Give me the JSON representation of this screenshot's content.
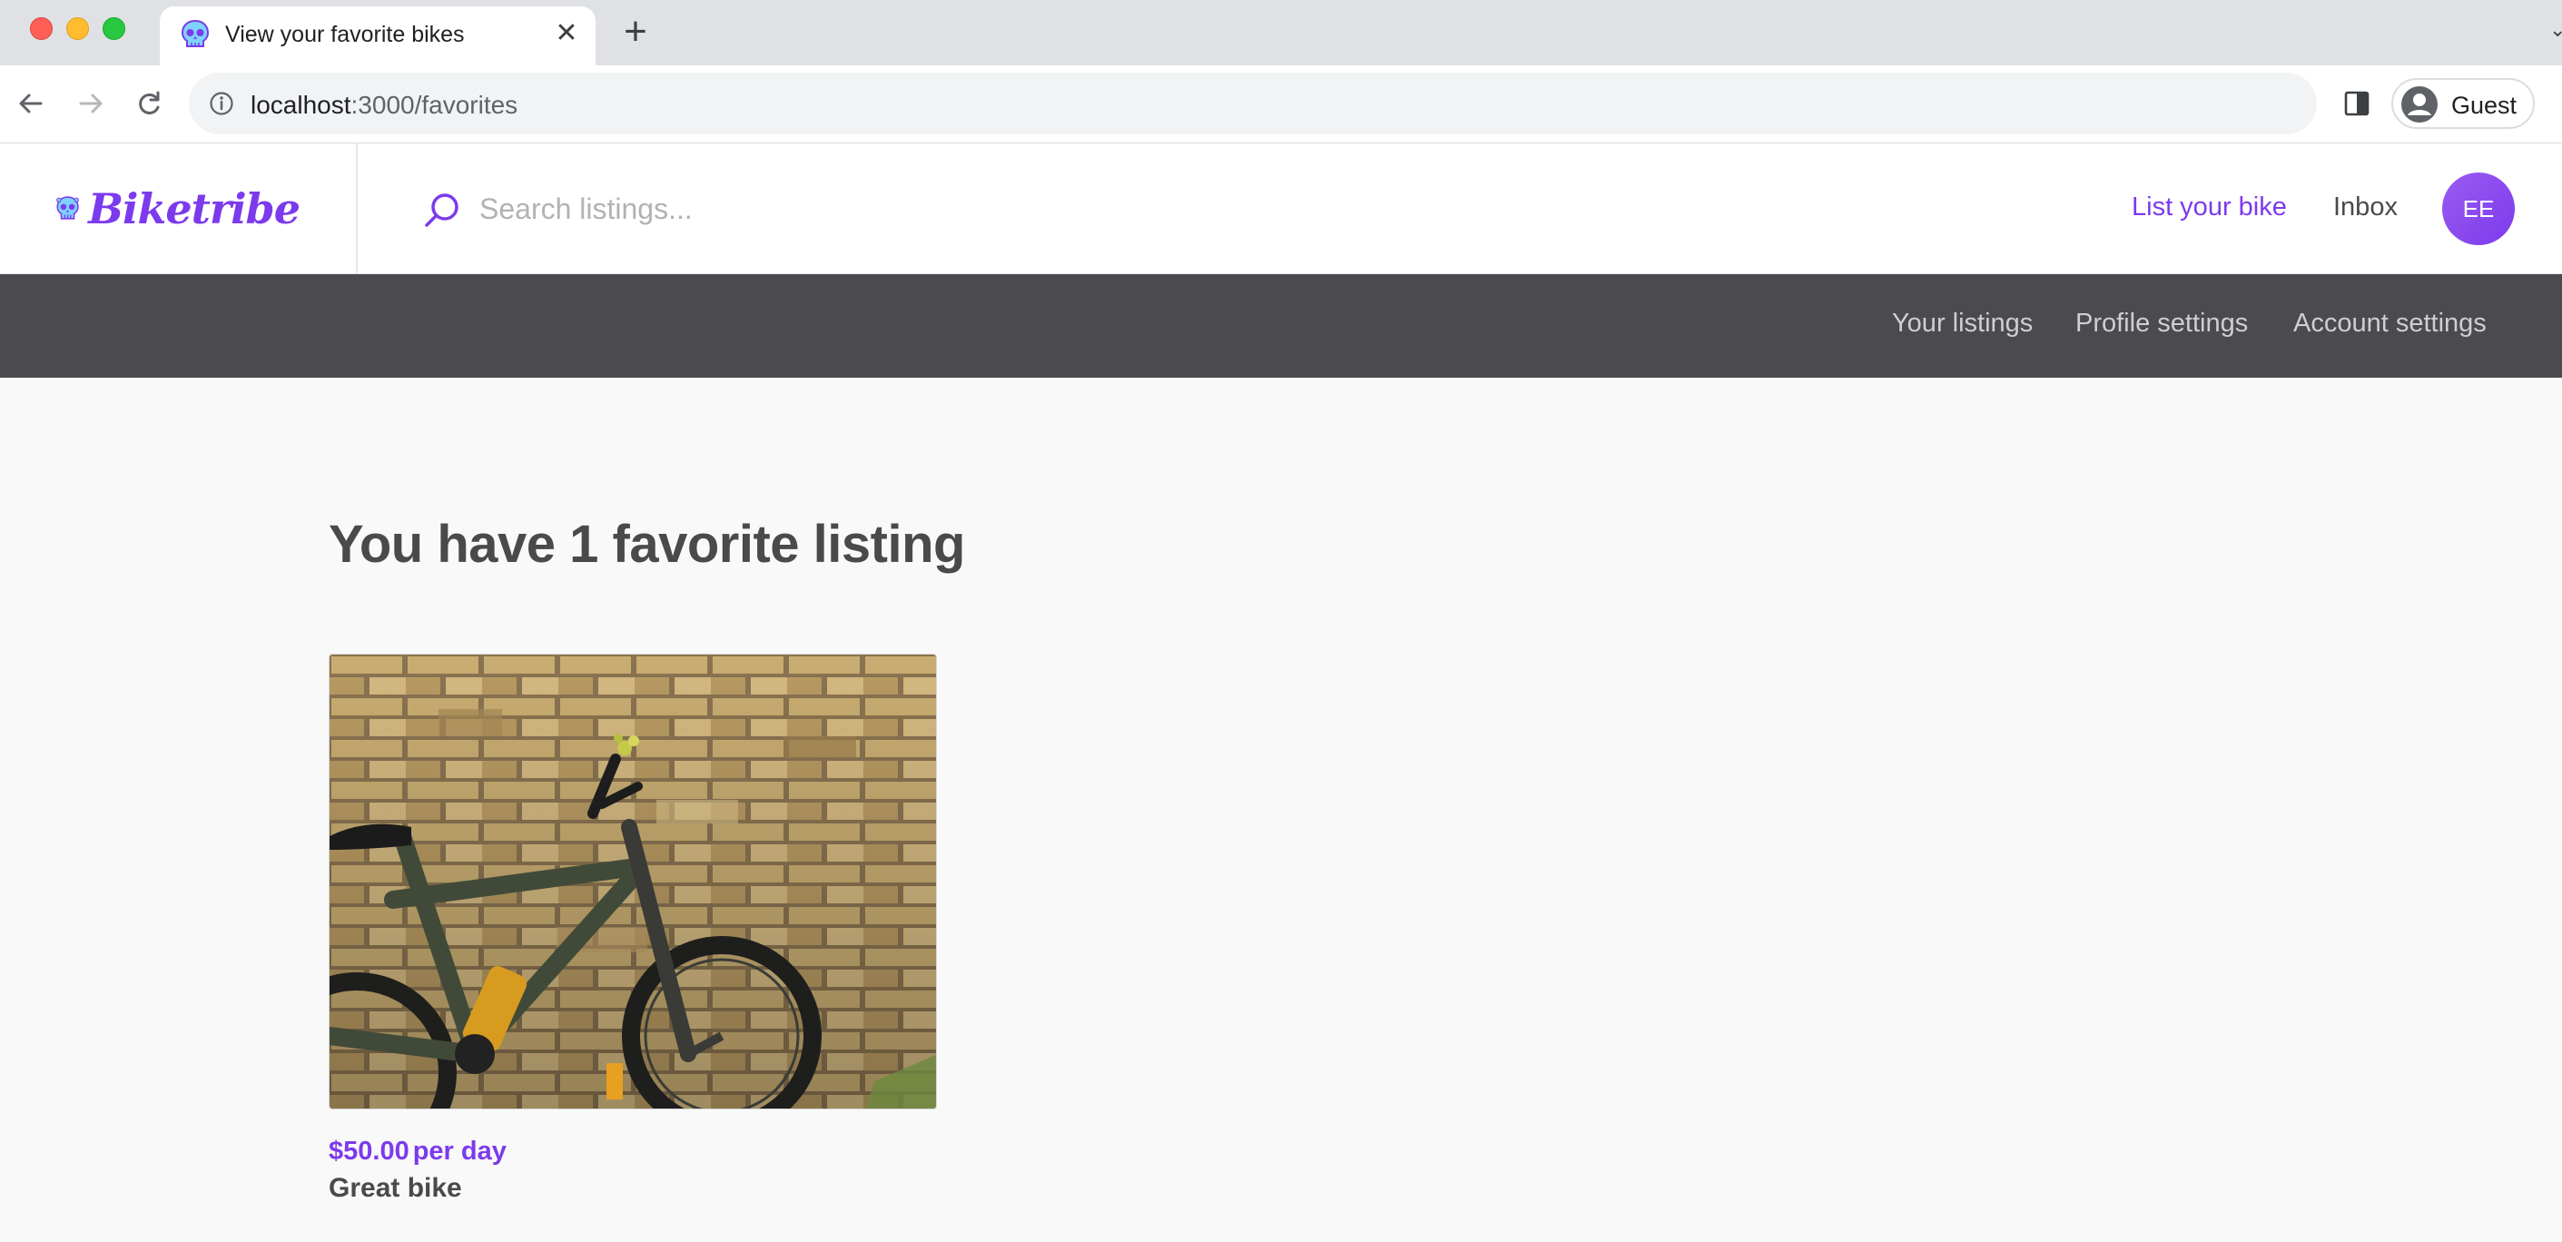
{
  "browser": {
    "tab": {
      "title": "View your favorite bikes",
      "favicon": "skull-icon",
      "close_icon": "close-icon"
    },
    "new_tab_icon": "plus-icon",
    "address": {
      "host": "localhost",
      "path": ":3000/favorites"
    },
    "profile": {
      "name": "Guest"
    }
  },
  "header": {
    "brand": "Biketribe",
    "search": {
      "placeholder": "Search listings..."
    },
    "list_bike": "List your bike",
    "inbox": "Inbox",
    "avatar_initials": "EE"
  },
  "subnav": {
    "items": [
      {
        "label": "Your listings"
      },
      {
        "label": "Profile settings"
      },
      {
        "label": "Account settings"
      }
    ]
  },
  "main": {
    "title": "You have 1 favorite listing",
    "listings": [
      {
        "price": "$50.00",
        "unit": "per day",
        "title": "Great bike",
        "image": "bike-leaning-on-brick-wall"
      }
    ]
  },
  "colors": {
    "accent": "#7c3aed",
    "subnav_bg": "#4a4a4f",
    "page_bg": "#f9f9f9",
    "text": "#4a4a4a"
  }
}
